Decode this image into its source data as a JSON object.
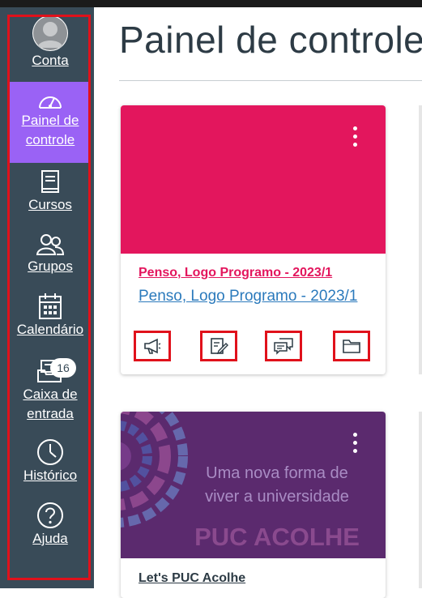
{
  "nav": {
    "account": "Conta",
    "dashboard_line1": "Painel de",
    "dashboard_line2": "controle",
    "courses": "Cursos",
    "groups": "Grupos",
    "calendar": "Calendário",
    "inbox_line1": "Caixa de",
    "inbox_line2": "entrada",
    "inbox_badge": "16",
    "history": "Histórico",
    "help": "Ajuda"
  },
  "page": {
    "title": "Painel de controle"
  },
  "cards": [
    {
      "code": "Penso, Logo Programo - 2023/1",
      "name": "Penso, Logo Programo - 2023/1",
      "color": "#e3165d",
      "actions": [
        "megaphone-icon",
        "assignment-icon",
        "discussion-icon",
        "folder-icon"
      ]
    },
    {
      "name": "Let's PUC Acolhe",
      "image_text_line1": "Uma  nova forma de",
      "image_text_line2": "viver a universidade",
      "image_title": "PUC ACOLHE",
      "color": "#5b2a6e"
    }
  ],
  "colors": {
    "sidebar": "#394b58",
    "active": "#9a62f5",
    "highlight": "#e0111b"
  }
}
